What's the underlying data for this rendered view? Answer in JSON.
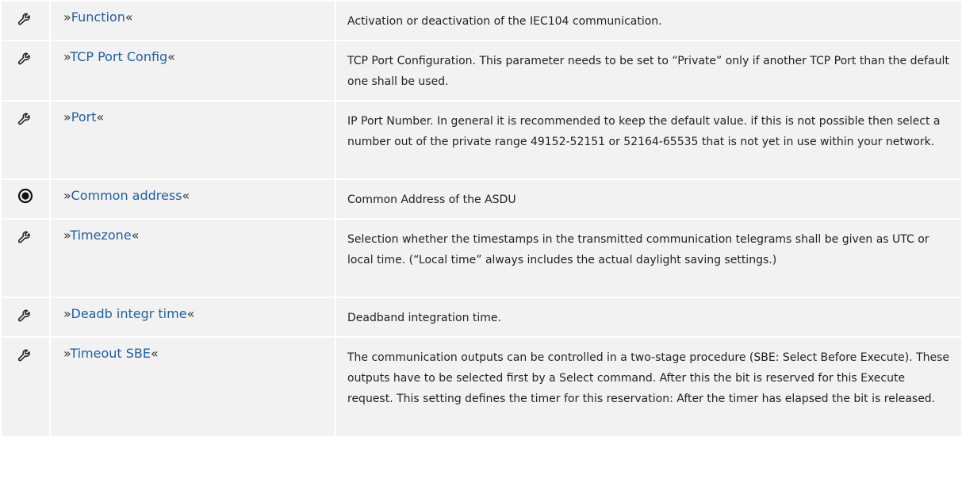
{
  "quote_open": "»",
  "quote_close": "«",
  "icons": {
    "wrench": "wrench-icon",
    "target": "target-icon"
  },
  "colors": {
    "link": "#1f5fa3",
    "cell_bg": "#f2f2f2"
  },
  "rows": [
    {
      "icon": "wrench",
      "name": "Function",
      "description": "Activation or deactivation of the IEC104 communication."
    },
    {
      "icon": "wrench",
      "name": "TCP Port Config",
      "description": "TCP Port Configuration. This parameter needs to be set to “Private” only if another TCP Port than the default one shall be used."
    },
    {
      "icon": "wrench",
      "name": "Port",
      "description": "IP Port Number. In general it is recommended to keep the default value. if this is not possible then select a number out of the private range 49152-52151 or 52164-65535 that is not yet in use within your network."
    },
    {
      "icon": "target",
      "name": "Common address",
      "description": "Common Address of the ASDU"
    },
    {
      "icon": "wrench",
      "name": "Timezone",
      "description": "Selection whether the timestamps in the transmitted communication telegrams shall be given as UTC or local time. (“Local time” always includes the actual daylight saving settings.)"
    },
    {
      "icon": "wrench",
      "name": "Deadb integr time",
      "description": "Deadband integration time."
    },
    {
      "icon": "wrench",
      "name": "Timeout SBE",
      "description": "The communication outputs can be controlled in a two-stage procedure (SBE: Select Before Execute). These outputs have to be selected first by a Select command. After this the bit is reserved for this Execute request. This setting defines the timer for this reservation: After the timer has elapsed the bit is released."
    }
  ]
}
